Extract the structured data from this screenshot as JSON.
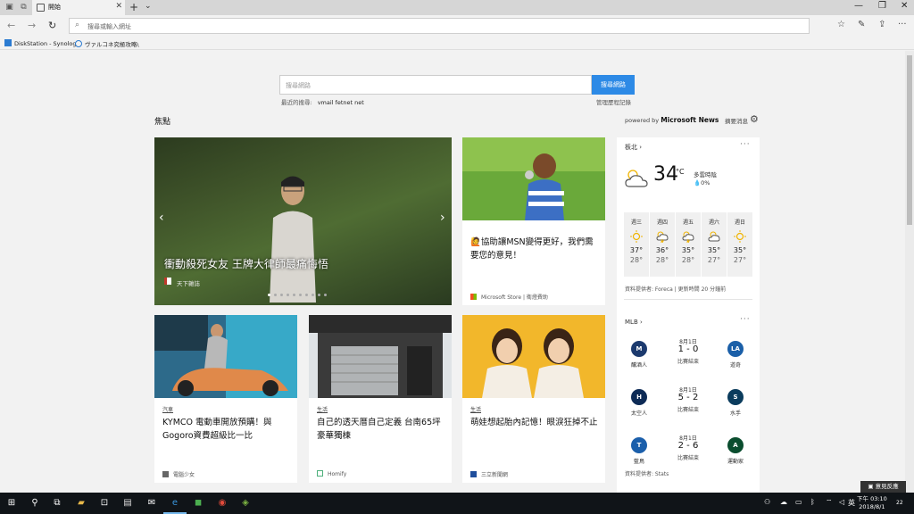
{
  "browser": {
    "tab_title": "開始",
    "address_placeholder": "搜尋或輸入網址",
    "favorites": [
      "DiskStation - Synolog",
      "ヴァルコネ究極攻略\\"
    ]
  },
  "page": {
    "search_placeholder": "搜尋網路",
    "search_button": "搜尋網路",
    "recent_label": "最近的搜尋:",
    "recent_query": "vmail fetnet net",
    "history_link": "管理歷程記錄",
    "section_title": "焦點",
    "powered_by": "powered by",
    "microsoft_news": "Microsoft News",
    "manage_link": "摘要消息"
  },
  "hero": {
    "headline": "衝動殺死女友 王牌大律師最痛悔悟",
    "source": "天下雜誌"
  },
  "cards": [
    {
      "category": "",
      "title": "🙋協助讓MSN變得更好，我們需要您的意見！",
      "source": "Microsoft Store | 衛燈費助"
    },
    {
      "category": "汽車",
      "title": "KYMCO 電動車開放預購！與Gogoro資費超級比一比",
      "source": "電腦少女"
    },
    {
      "category": "生活",
      "title": "自己的透天厝自己定義 台南65坪豪華獨棟",
      "source": "Homify"
    },
    {
      "category": "生活",
      "title": "萌娃想起胎內記憶！眼淚狂掉不止",
      "source": "三立新聞網"
    }
  ],
  "weather": {
    "location": "板北",
    "more": "···",
    "temp": "34",
    "unit": "°C",
    "condition": "多雲時陰",
    "rain": "💧0%",
    "days": [
      {
        "name": "週三",
        "hi": "37°",
        "lo": "28°",
        "icon": "sun-icon"
      },
      {
        "name": "週四",
        "hi": "36°",
        "lo": "28°",
        "icon": "thunder-icon"
      },
      {
        "name": "週五",
        "hi": "35°",
        "lo": "28°",
        "icon": "thunder-icon"
      },
      {
        "name": "週六",
        "hi": "35°",
        "lo": "27°",
        "icon": "partly-cloudy-icon"
      },
      {
        "name": "週日",
        "hi": "35°",
        "lo": "27°",
        "icon": "sun-icon"
      }
    ],
    "info": "資料提供者: Foreca | 更新時間 20 分鐘前"
  },
  "mlb": {
    "title": "MLB",
    "more": "···",
    "games": [
      {
        "date": "8月1日",
        "score": "1 - 0",
        "status": "比賽結束",
        "away": "釀酒人",
        "home": "道奇",
        "away_color": "#1c3a6e",
        "home_color": "#1a5fa8",
        "away_abbr": "M",
        "home_abbr": "LA"
      },
      {
        "date": "8月1日",
        "score": "5 - 2",
        "status": "比賽結束",
        "away": "太空人",
        "home": "水手",
        "away_color": "#0e2b56",
        "home_color": "#0b3c5d",
        "away_abbr": "H",
        "home_abbr": "S"
      },
      {
        "date": "8月1日",
        "score": "2 - 6",
        "status": "比賽結束",
        "away": "藍鳥",
        "home": "運動家",
        "away_color": "#1b5fab",
        "home_color": "#0a4d2e",
        "away_abbr": "T",
        "home_abbr": "A"
      }
    ],
    "info": "資料提供者: Stats"
  },
  "feedback": "意見反應",
  "taskbar": {
    "time": "下午 03:10",
    "date": "2018/8/1",
    "badge": "22",
    "ime": "英"
  }
}
